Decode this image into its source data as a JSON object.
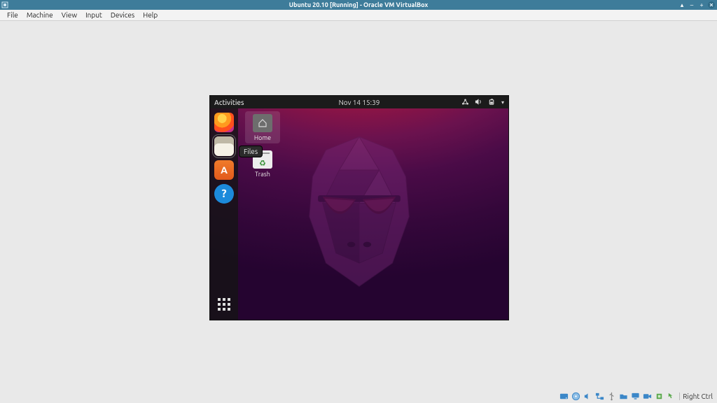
{
  "host": {
    "title": "Ubuntu 20.10 [Running] - Oracle VM VirtualBox",
    "menu": [
      "File",
      "Machine",
      "View",
      "Input",
      "Devices",
      "Help"
    ],
    "host_key": "Right Ctrl",
    "window_controls": {
      "up": "▴",
      "min": "–",
      "max": "+",
      "close": "✕"
    }
  },
  "guest": {
    "activities_label": "Activities",
    "clock": "Nov 14  15:39",
    "sys_icons": {
      "network": "network-icon",
      "volume": "volume-icon",
      "power": "power-icon",
      "menu_arrow": "▾"
    },
    "dock": [
      {
        "id": "firefox",
        "tooltip": "Firefox Web Browser"
      },
      {
        "id": "files",
        "tooltip": "Files",
        "active": true
      },
      {
        "id": "software",
        "tooltip": "Ubuntu Software"
      },
      {
        "id": "help",
        "tooltip": "Help"
      }
    ],
    "show_apps_label": "Show Applications",
    "active_tooltip": "Files",
    "desktop_icons": {
      "home": "Home",
      "trash": "Trash"
    }
  },
  "colors": {
    "titlebar": "#3e7c9a",
    "panel": "#1b1b1b"
  }
}
